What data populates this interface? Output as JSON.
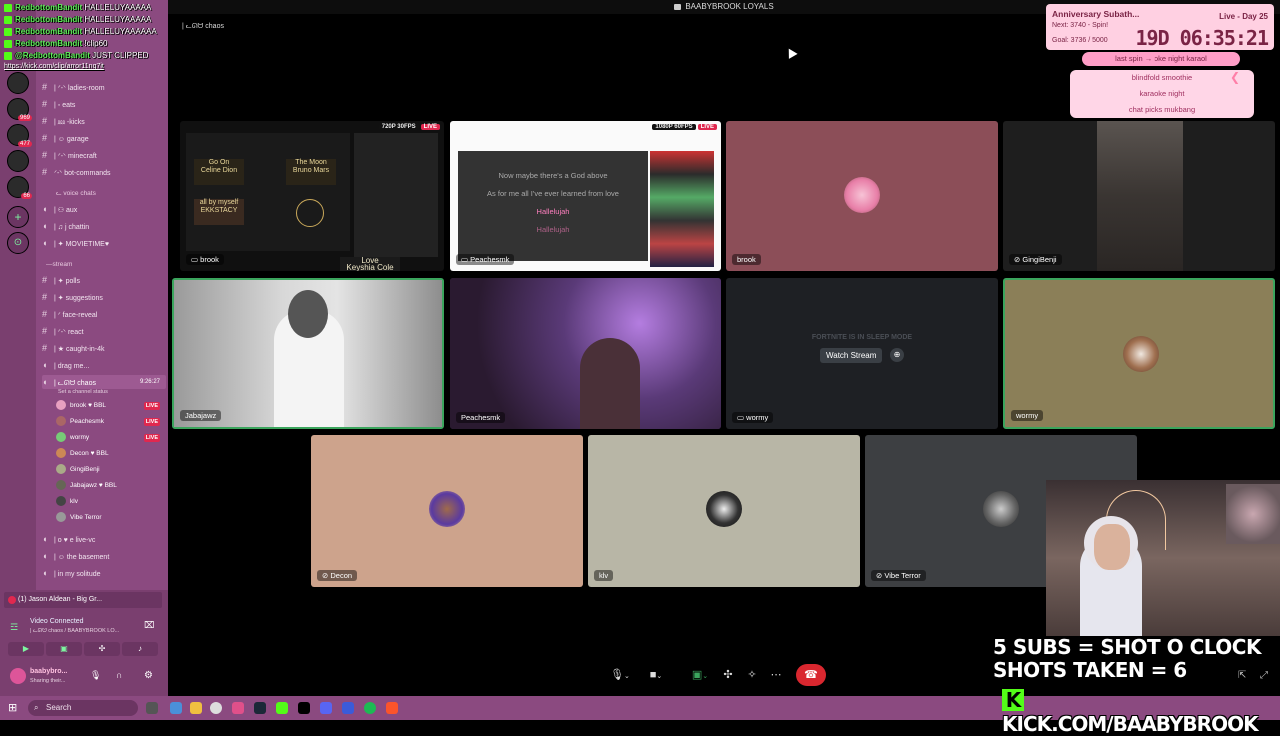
{
  "window": {
    "title": "BAABYBROOK LOYALS"
  },
  "voice_header": "| ᓚᘏᗢ chaos",
  "chat": [
    {
      "user": "RedbottomBandit",
      "text": "HALLELUYAAAAA"
    },
    {
      "user": "RedbottomBandit",
      "text": "HALLELUYAAAAA"
    },
    {
      "user": "RedbottomBandit",
      "text": "HALLELUYAAAAAA"
    },
    {
      "user": "RedbottomBandit",
      "text": "!clip60"
    },
    {
      "user": "@RedbottomBandit",
      "text": "JUST CLIPPED"
    }
  ],
  "clip_link": "https://kick.com/clip/arror11nq7it",
  "sidebar": {
    "channels": [
      {
        "label": "| ᐟ-ᐠ ladies-room",
        "type": "text"
      },
      {
        "label": "| ◦ eats",
        "type": "text"
      },
      {
        "label": "| ⅏ -kicks",
        "type": "text"
      },
      {
        "label": "| ☺ garage",
        "type": "text"
      },
      {
        "label": "| ᐟ-ᐠ minecraft",
        "type": "text"
      },
      {
        "label": "ᐟ-ᐠ bot-commands",
        "type": "text"
      }
    ],
    "category_voice": "ᓚ voice chats",
    "voice_channels": [
      {
        "label": "| ⚇ aux"
      },
      {
        "label": "| ♫ j chattin"
      },
      {
        "label": "| ✦ MOVIETIME♥"
      }
    ],
    "category_stream": "—stream",
    "stream_channels": [
      {
        "label": "| ✦ polls"
      },
      {
        "label": "| ✦ suggestions"
      },
      {
        "label": "| ᐟ face-reveal"
      },
      {
        "label": "| ᐟ-ᐠ react"
      },
      {
        "label": "| ★ caught-in-4k"
      },
      {
        "label": "| drag me..."
      }
    ],
    "active_voice": {
      "label": "| ᓚᘏᗢ chaos",
      "time": "9:26:27",
      "status": "Set a channel status"
    },
    "voice_users": [
      {
        "name": "brook",
        "tag": "♥ BBL",
        "live": "LIVE"
      },
      {
        "name": "Peachesmk",
        "tag": "",
        "live": "LIVE"
      },
      {
        "name": "wormy",
        "tag": "",
        "live": "LIVE"
      },
      {
        "name": "Decon",
        "tag": "♥ BBL",
        "live": ""
      },
      {
        "name": "GingiBenji",
        "tag": "",
        "live": ""
      },
      {
        "name": "Jabajawz",
        "tag": "♥ BBL",
        "live": ""
      },
      {
        "name": "klv",
        "tag": "",
        "live": ""
      },
      {
        "name": "Vibe Terror",
        "tag": "",
        "live": ""
      }
    ],
    "more_channels": [
      {
        "label": "| o ♥ e live-vc"
      },
      {
        "label": "| ☺ the basement"
      },
      {
        "label": "| in my solitude"
      }
    ],
    "server_badges": [
      "969",
      "477",
      "66"
    ]
  },
  "panel": {
    "now_playing": "(1) Jason Aldean - Big Gr...",
    "video_connected": "Video Connected",
    "video_sub": "| ᓚᘏᗢ chaos / BAABYBROOK LO...",
    "user_name": "baabybro...",
    "user_status": "Sharing their..."
  },
  "tiles": [
    {
      "id": "brook-screen",
      "label": "brook",
      "quality": "720P 30FPS",
      "live": "LIVE"
    },
    {
      "id": "peaches-screen",
      "label": "Peachesmk",
      "quality": "1080P 60FPS",
      "live": "LIVE"
    },
    {
      "id": "brook-cam",
      "label": "brook"
    },
    {
      "id": "gingi-cam",
      "label": "GingiBenji"
    },
    {
      "id": "jabajawz-cam",
      "label": "Jabajawz"
    },
    {
      "id": "peaches-cam",
      "label": "Peachesmk"
    },
    {
      "id": "wormy-stream",
      "label": "wormy",
      "sleep": "FORTNITE IS IN SLEEP MODE",
      "button": "Watch Stream"
    },
    {
      "id": "wormy-cam",
      "label": "wormy"
    },
    {
      "id": "decon-cam",
      "label": "Decon"
    },
    {
      "id": "klv-cam",
      "label": "klv"
    },
    {
      "id": "vibe-cam",
      "label": "Vibe Terror"
    }
  ],
  "screen1": {
    "cards": [
      "Go On\nCeline Dion",
      "The Moon\nBruno Mars",
      "all by myself\nEKKSTACY",
      "Love\nKeyshia Cole"
    ]
  },
  "screen2": {
    "lyrics": [
      "Now maybe there's a God above",
      "As for me all I've ever learned from love",
      "Hallelujah",
      "Hallelujah"
    ]
  },
  "overlay": {
    "sub_title": "Anniversary Subath...",
    "sub_day": "Live - Day 25",
    "sub_next": "Next: 3740 - Spin!",
    "sub_goal": "Goal: 3736 / 5000",
    "timer": "19D 06:35:21",
    "wheel_head": "last spin → ɔke night karaol",
    "wheel_items": [
      "blindfold smoothie",
      "karaoke night",
      "chat picks mukbang"
    ],
    "shots_line1": "5 SUBS = SHOT O CLOCK",
    "shots_line2": "SHOTS TAKEN = 6",
    "kick_url": "KICK.COM/BAABYBROOK",
    "kick_logo": "K"
  },
  "taskbar": {
    "search": "Search"
  },
  "colors": {
    "sidebar": "#8b4a80",
    "rail": "#7a3f6f",
    "speaking": "#3ba55d",
    "live": "#e0284f",
    "kick_green": "#53fc18"
  }
}
